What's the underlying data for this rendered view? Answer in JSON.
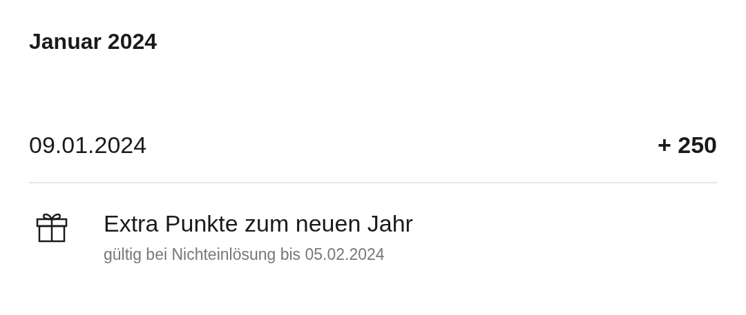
{
  "month": "Januar 2024",
  "entry": {
    "date": "09.01.2024",
    "points": "+ 250"
  },
  "detail": {
    "title": "Extra Punkte zum neuen Jahr",
    "note": "gültig bei Nichteinlösung bis 05.02.2024"
  }
}
